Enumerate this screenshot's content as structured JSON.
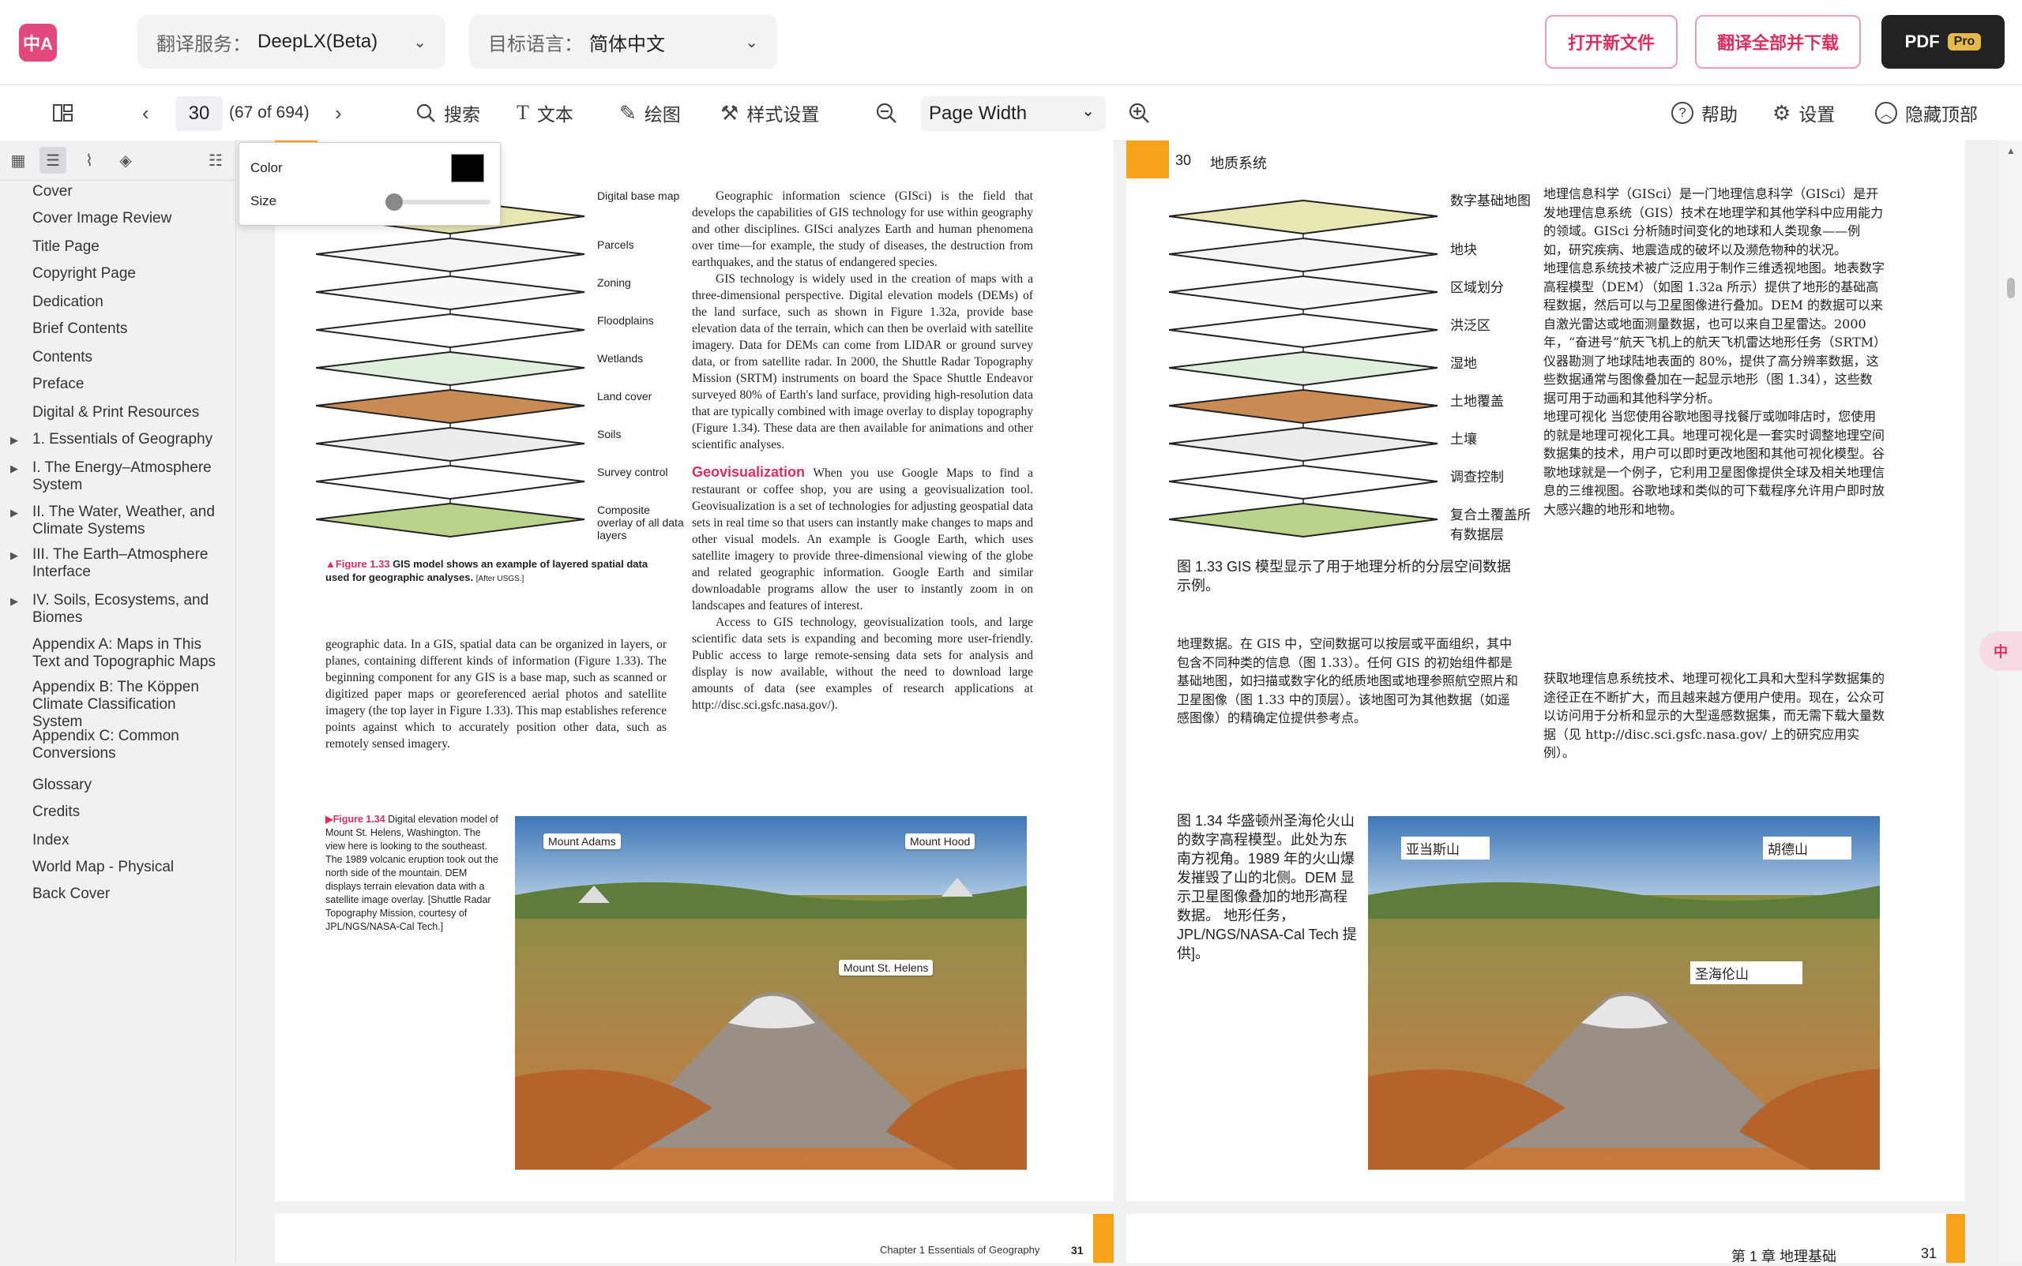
{
  "topbar": {
    "logo_text": "中A",
    "service_label": "翻译服务：",
    "service_value": "DeepLX(Beta)",
    "lang_label": "目标语言：",
    "lang_value": "简体中文",
    "open_file": "打开新文件",
    "translate_all": "翻译全部并下载",
    "pdf": "PDF",
    "pro": "Pro"
  },
  "toolbar": {
    "page_number": "30",
    "page_count": "(67 of 694)",
    "search": "搜索",
    "text": "文本",
    "draw": "绘图",
    "style": "样式设置",
    "zoom_value": "Page Width",
    "help": "帮助",
    "settings": "设置",
    "hide_top": "隐藏顶部"
  },
  "popup": {
    "color_label": "Color",
    "size_label": "Size",
    "color_value": "#000000",
    "size_level": 0.05
  },
  "toc": [
    {
      "label": "Cover",
      "expandable": false
    },
    {
      "label": "Cover Image Review",
      "expandable": false
    },
    {
      "label": "Title Page",
      "expandable": false
    },
    {
      "label": "Copyright Page",
      "expandable": false
    },
    {
      "label": "Dedication",
      "expandable": false
    },
    {
      "label": "Brief Contents",
      "expandable": false
    },
    {
      "label": "Contents",
      "expandable": false
    },
    {
      "label": "Preface",
      "expandable": false
    },
    {
      "label": "Digital & Print Resources",
      "expandable": false
    },
    {
      "label": "1. Essentials of Geography",
      "expandable": true
    },
    {
      "label": "I. The Energy–Atmosphere System",
      "expandable": true
    },
    {
      "label": "II. The Water, Weather, and Climate Systems",
      "expandable": true
    },
    {
      "label": "III. The Earth–Atmosphere Interface",
      "expandable": true
    },
    {
      "label": "IV. Soils, Ecosystems, and Biomes",
      "expandable": true
    },
    {
      "label": "Appendix A: Maps in This Text and Topographic Maps",
      "expandable": false
    },
    {
      "label": "Appendix B: The Köppen Climate Classification System",
      "expandable": false
    },
    {
      "label": "Appendix C: Common Conversions",
      "expandable": false
    },
    {
      "label": "Glossary",
      "expandable": false
    },
    {
      "label": "Credits",
      "expandable": false
    },
    {
      "label": "Index",
      "expandable": false
    },
    {
      "label": "World Map - Physical",
      "expandable": false
    },
    {
      "label": "Back Cover",
      "expandable": false
    }
  ],
  "left_page": {
    "layers": [
      "Digital base map",
      "Parcels",
      "Zoning",
      "Floodplains",
      "Wetlands",
      "Land cover",
      "Soils",
      "Survey control",
      "Composite overlay of all data layers"
    ],
    "fig133_label": "▲Figure 1.33",
    "fig133_caption": "GIS model shows an example of layered spatial data used for geographic analyses.",
    "fig133_credit": "[After USGS.]",
    "col1_text": "geographic data. In a GIS, spatial data can be organized in layers, or planes, containing different kinds of information (Figure 1.33). The beginning component for any GIS is a base map, such as scanned or digitized paper maps or georeferenced aerial photos and satellite imagery (the top layer in Figure 1.33). This map establishes reference points against which to accurately position other data, such as remotely sensed imagery.",
    "col2_p1": "Geographic information science (GISci) is the field that develops the capabilities of GIS technology for use within geography and other disciplines. GISci analyzes Earth and human phenomena over time—for example, the study of diseases, the destruction from earthquakes, and the status of endangered species.",
    "col2_p2": "GIS technology is widely used in the creation of maps with a three-dimensional perspective. Digital elevation models (DEMs) of the land surface, such as shown in Figure 1.32a, provide base elevation data of the terrain, which can then be overlaid with satellite imagery. Data for DEMs can come from LIDAR or ground survey data, or from satellite radar. In 2000, the Shuttle Radar Topography Mission (SRTM) instruments on board the Space Shuttle Endeavor surveyed 80% of Earth's land surface, providing high-resolution data that are typically combined with image overlay to display topography (Figure 1.34). These data are then available for animations and other scientific analyses.",
    "geovis_heading": "Geovisualization",
    "col2_p3": "When you use Google Maps to find a restaurant or coffee shop, you are using a geovisualization tool. Geovisualization is a set of technologies for adjusting geospatial data sets in real time so that users can instantly make changes to maps and other visual models. An example is Google Earth, which uses satellite imagery to provide three-dimensional viewing of the globe and related geographic information. Google Earth and similar downloadable programs allow the user to instantly zoom in on landscapes and features of interest.",
    "col2_p4": "Access to GIS technology, geovisualization tools, and large scientific data sets is expanding and becoming more user-friendly. Public access to large remote-sensing data sets for analysis and display is now available, without the need to download large amounts of data (see examples of research applications at http://disc.sci.gsfc.nasa.gov/).",
    "fig134_label": "▶Figure 1.34",
    "fig134_caption": "Digital elevation model of Mount St. Helens, Washington. The view here is looking to the southeast. The 1989 volcanic eruption took out the north side of the mountain. DEM displays terrain elevation data with a satellite image overlay. [Shuttle Radar Topography Mission, courtesy of JPL/NGS/NASA-Cal Tech.]",
    "mt_adams": "Mount Adams",
    "mt_hood": "Mount Hood",
    "mt_helens": "Mount St. Helens",
    "footer_chapter": "Chapter 1  Essentials of Geography",
    "footer_page": "31"
  },
  "right_page": {
    "page_num": "30",
    "header": "地质系统",
    "layers": [
      "数字基础地图",
      "地块",
      "区域划分",
      "洪泛区",
      "湿地",
      "土地覆盖",
      "土壤",
      "调查控制",
      "复合土覆盖所有数据层"
    ],
    "fig133_caption": "图 1.33 GIS 模型显示了用于地理分析的分层空间数据示例。",
    "col2_p1": "地理信息科学（GISci）是一门地理信息科学（GISci）是开发地理信息系统（GIS）技术在地理学和其他学科中应用能力的领域。GISci 分析随时间变化的地球和人类现象——例如，研究疾病、地震造成的破坏以及濒危物种的状况。",
    "col2_p2": "地理信息系统技术被广泛应用于制作三维透视地图。地表数字高程模型（DEM）（如图 1.32a 所示）提供了地形的基础高程数据，然后可以与卫星图像进行叠加。DEM 的数据可以来自激光雷达或地面测量数据，也可以来自卫星雷达。2000 年，“奋进号”航天飞机上的航天飞机雷达地形任务（SRTM）仪器勘测了地球陆地表面的 80%，提供了高分辨率数据，这些数据通常与图像叠加在一起显示地形（图 1.34），这些数据可用于动画和其他科学分析。",
    "col2_p3": "地理可视化 当您使用谷歌地图寻找餐厅或咖啡店时，您使用的就是地理可视化工具。地理可视化是一套实时调整地理空间数据集的技术，用户可以即时更改地图和其他可视化模型。谷歌地球就是一个例子，它利用卫星图像提供全球及相关地理信息的三维视图。谷歌地球和类似的可下载程序允许用户即时放大感兴趣的地形和地物。",
    "col1_text": "地理数据。在 GIS 中，空间数据可以按层或平面组织，其中包含不同种类的信息（图 1.33）。任何 GIS 的初始组件都是基础地图，如扫描或数字化的纸质地图或地理参照航空照片和卫星图像（图 1.33 中的顶层）。该地图可为其他数据（如遥感图像）的精确定位提供参考点。",
    "col2_p4": "获取地理信息系统技术、地理可视化工具和大型科学数据集的途径正在不断扩大，而且越来越方便用户使用。现在，公众可以访问用于分析和显示的大型遥感数据集，而无需下载大量数据（见 http://disc.sci.gsfc.nasa.gov/ 上的研究应用实例）。",
    "fig134_caption": "图 1.34 华盛顿州圣海伦火山的数字高程模型。此处为东南方视角。1989 年的火山爆发摧毁了山的北侧。DEM 显示卫星图像叠加的地形高程数据。 地形任务，JPL/NGS/NASA-Cal Tech 提供]。",
    "mt_adams": "亚当斯山",
    "mt_hood": "胡德山",
    "mt_helens": "圣海伦山",
    "footer_chapter": "第 1 章 地理基础",
    "footer_page": "31"
  },
  "colors": {
    "accent": "#d9305f",
    "tab_orange": "#f7a21b",
    "dark": "#222222"
  }
}
